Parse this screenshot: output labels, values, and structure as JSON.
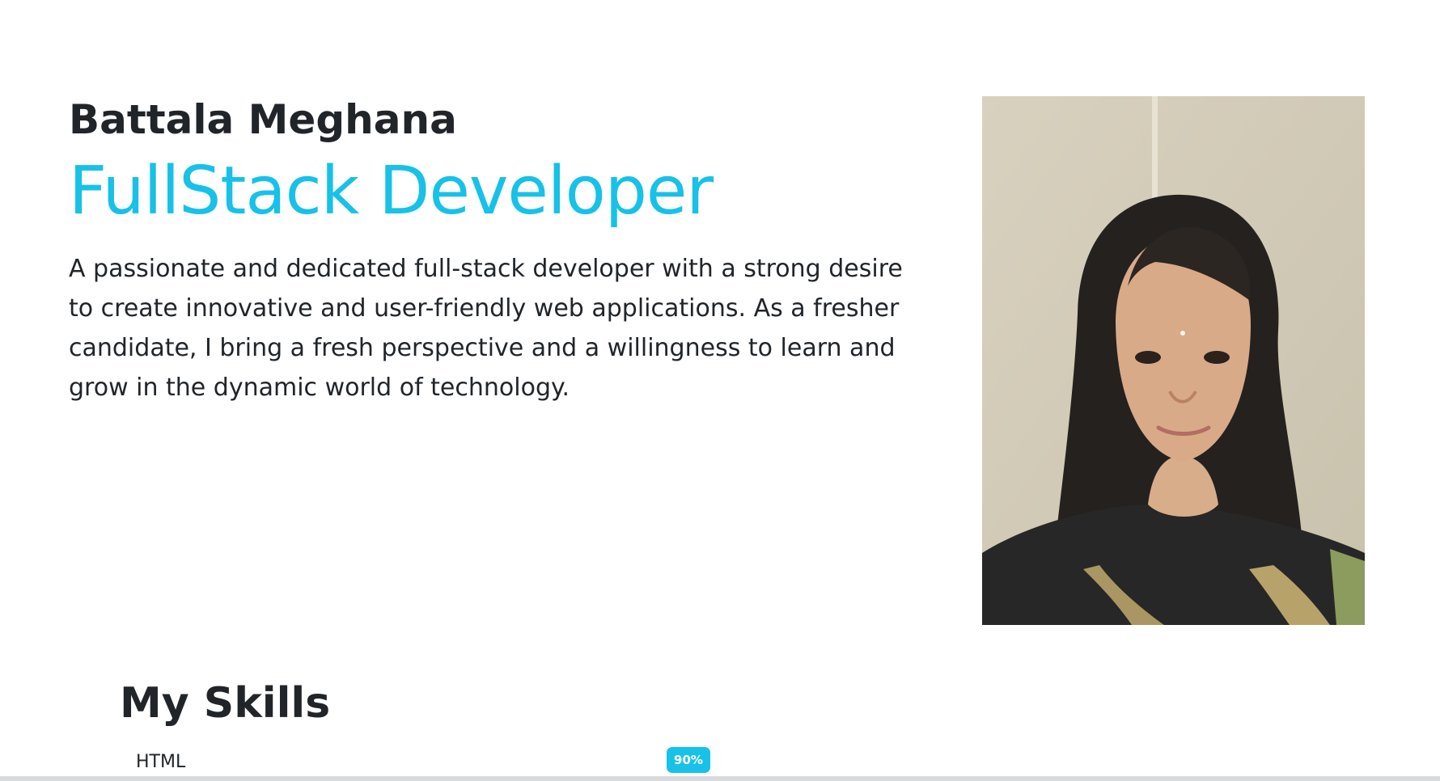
{
  "hero": {
    "name": "Battala Meghana",
    "role": "FullStack Developer",
    "bio": "A passionate and dedicated full-stack developer with a strong desire to create innovative and user-friendly web applications. As a fresher candidate, I bring a fresh perspective and a willingness to learn and grow in the dynamic world of technology."
  },
  "skills": {
    "title": "My Skills",
    "items": [
      {
        "label": "HTML",
        "percent_label": "90%",
        "value": 90
      }
    ]
  },
  "colors": {
    "accent": "#17c1e8",
    "text": "#212529",
    "background": "#ffffff"
  }
}
